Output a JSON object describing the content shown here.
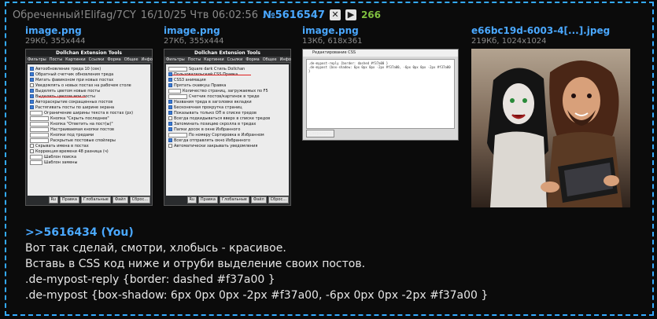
{
  "header": {
    "name": "Обреченный!Elifag/7CY",
    "date": "16/10/25 Чтв 06:02:56",
    "post_number": "№5616547",
    "hide_icon": "close-icon",
    "play_icon": "play-icon",
    "hide_glyph": "✕",
    "play_glyph": "▶",
    "reply_count": "266"
  },
  "files": [
    {
      "name": "image.png",
      "info": "29Кб, 355x444"
    },
    {
      "name": "image.png",
      "info": "27Кб, 355x444"
    },
    {
      "name": "image.png",
      "info": "13Кб, 618x361"
    },
    {
      "name": "e66bc19d-6003-4[...].jpeg",
      "info": "219Кб, 1024x1024"
    }
  ],
  "dollchan": {
    "title": "Dollchan Extension Tools",
    "tabs": [
      "Фильтры",
      "Посты",
      "Картинки",
      "Ссылки",
      "Форма",
      "Общее",
      "Инфо"
    ],
    "buttons": [
      "Ru",
      "Правка",
      "Глобальные",
      "Файл",
      "Сброс..."
    ]
  },
  "thumb1_rows": [
    "Автообновление треда 10 (сек)",
    "Обратный счетчик обновления треда",
    "Мигать фавиконом при новых постах",
    "Уведомлять о новых постах на рабочем столе",
    "Выделять цветом новые посты",
    "Выделять цветом мои посты",
    "Автораскрытие сокращенных постов",
    "Растягивать посты по ширине экрана",
    "Ограничение ширины текста в постах (px)",
    "Кнопка \"Скрыть последнее\"",
    "Кнопка \"Ответить на пост(ы)\"",
    "Настраиваемая кнопки постов",
    "Кнопки под тредами",
    "Раскрытые постовые спойлеры",
    "Скрывать имена в постах",
    "Коррекция времени 48 разница (ч)",
    "Шаблон поиска",
    "Шаблон замены"
  ],
  "thumb2_rows": [
    "Square dark  Стиль Dollchan",
    "Пользовательский CSS  Правка",
    "CSS3 анимация",
    "Прятать скавкуш  Правка",
    "Количество страниц, загружаемых по F5",
    "Счетчик постов/картинок в треде",
    "Названия треда в заголовке вкладки",
    "Бесконечная прокрутка страниц",
    "Показывать только ОП в списке тредов",
    "Всегда подкидываться вверх в списке тредов",
    "Запоминать позицию скролла в тредах",
    "Папки досок в окне Избранного",
    "По номеру  Сортировка в Избранном",
    "Всегда отправлять окно Избранного",
    "Автоматически закрывать уведомления"
  ],
  "editor": {
    "title": "Редактирование CSS",
    "lines": [
      ".de-mypost-reply {border: dashed #f37a00 }",
      ".de-mypost {box-shadow: 6px 0px 0px -2px #f37a00, -6px 0px 0px -2px #f37a00 }"
    ],
    "save": "Сохранить"
  },
  "body": {
    "quote": ">>5616434 (You)",
    "lines": [
      "Вот так сделай, смотри, хлобысь - красивое.",
      "Вставь в CSS код ниже и отруби выделение своих постов.",
      ".de-mypost-reply {border: dashed #f37a00 }",
      ".de-mypost {box-shadow: 6px 0px 0px -2px #f37a00, -6px 0px 0px -2px #f37a00 }"
    ]
  },
  "colors": {
    "accent": "#4aa8ff",
    "border": "#33aaff",
    "count": "#7fbf3f",
    "highlight": "#e02020"
  }
}
